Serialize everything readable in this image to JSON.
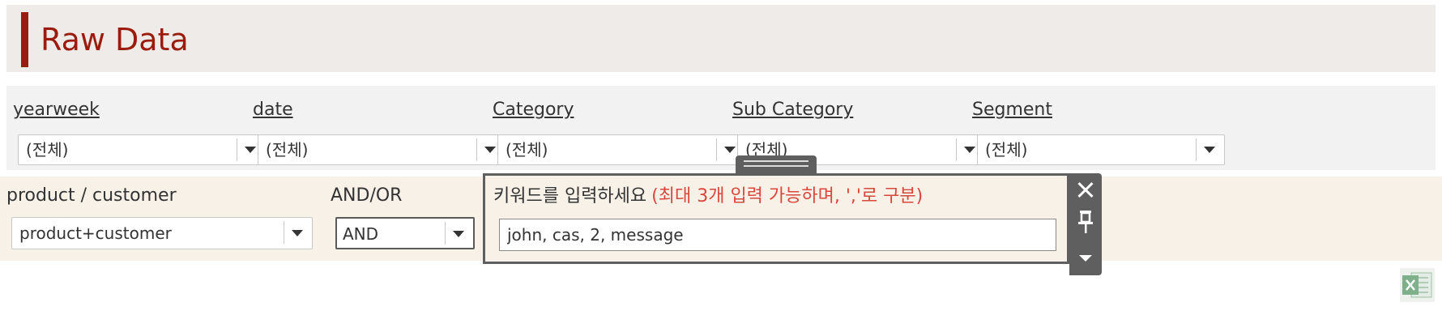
{
  "title": "Raw Data",
  "filters": [
    {
      "label": "yearweek",
      "value": "(전체)"
    },
    {
      "label": "date",
      "value": "(전체)"
    },
    {
      "label": "Category",
      "value": "(전체)"
    },
    {
      "label": "Sub Category",
      "value": "(전체)"
    },
    {
      "label": "Segment",
      "value": "(전체)"
    }
  ],
  "search": {
    "target_label": "product / customer",
    "target_value": "product+customer",
    "operator_label": "AND/OR",
    "operator_value": "AND",
    "keyword_prompt": "키워드를 입력하세요",
    "keyword_hint": "(최대 3개 입력 가능하며, ','로 구분)",
    "keyword_value": "john, cas, 2, message"
  },
  "icons": {
    "panel_close": "close-icon",
    "panel_pin": "pin-icon",
    "panel_menu": "dropdown-arrow-icon",
    "export": "excel-icon"
  },
  "colors": {
    "title": "#9b1b0d",
    "title_band": "#eeebe9",
    "filter_band": "#f2f2f2",
    "search_band": "#f7f1e8",
    "hint": "#d9463b",
    "panel_border": "#5f5f5f",
    "excel_green": "#7fb08b"
  }
}
